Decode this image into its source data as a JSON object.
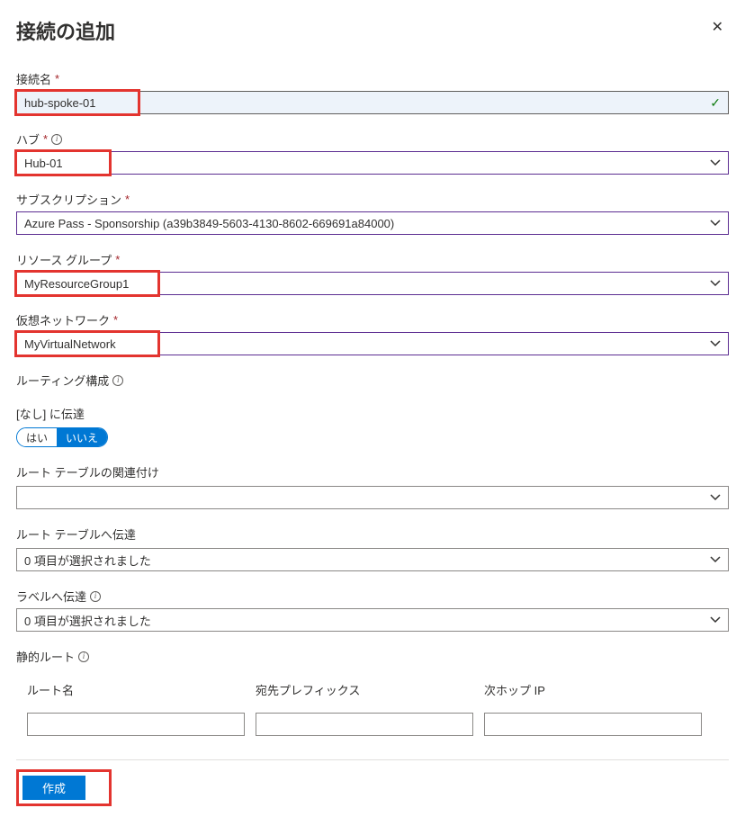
{
  "header": {
    "title": "接続の追加"
  },
  "fields": {
    "conn_name": {
      "label": "接続名",
      "value": "hub-spoke-01"
    },
    "hub": {
      "label": "ハブ",
      "value": "Hub-01"
    },
    "subscription": {
      "label": "サブスクリプション",
      "value": "Azure Pass - Sponsorship (a39b3849-5603-4130-8602-669691a84000)"
    },
    "resource_group": {
      "label": "リソース グループ",
      "value": "MyResourceGroup1"
    },
    "vnet": {
      "label": "仮想ネットワーク",
      "value": "MyVirtualNetwork"
    }
  },
  "routing": {
    "section_label": "ルーティング構成",
    "propagate_none_label": "[なし] に伝達",
    "yes": "はい",
    "no": "いいえ",
    "route_table_assoc_label": "ルート テーブルの関連付け",
    "route_table_assoc_value": "",
    "route_table_prop_label": "ルート テーブルへ伝達",
    "route_table_prop_value": "0 項目が選択されました",
    "label_prop_label": "ラベルへ伝達",
    "label_prop_value": "0 項目が選択されました"
  },
  "static_routes": {
    "section_label": "静的ルート",
    "col_route_name": "ルート名",
    "col_dest_prefix": "宛先プレフィックス",
    "col_next_hop": "次ホップ IP"
  },
  "footer": {
    "create": "作成"
  },
  "required_marker": "*"
}
